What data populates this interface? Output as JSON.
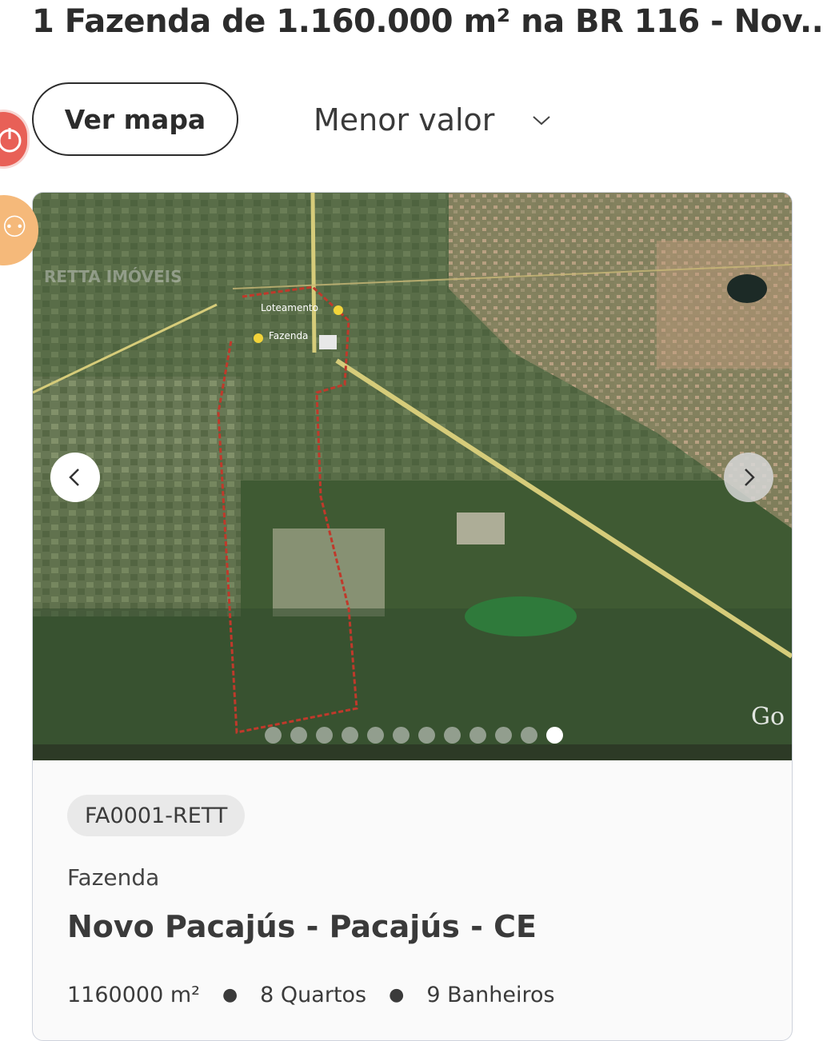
{
  "header": {
    "title": "1 Fazenda de 1.160.000 m² na BR 116 - Nov..."
  },
  "toolbar": {
    "map_button": "Ver mapa",
    "sort_selected": "Menor valor"
  },
  "listing": {
    "photo_overlay": {
      "watermark": "RETTA IMÓVEIS",
      "label_1": "Loteamento",
      "label_2": "Fazenda",
      "corner_text": "Go"
    },
    "carousel": {
      "total": 12,
      "active": 12
    },
    "code": "FA0001-RETT",
    "property_type": "Fazenda",
    "location": "Novo Pacajús - Pacajús - CE",
    "features": {
      "area": "1160000 m²",
      "rooms": "8 Quartos",
      "baths": "9 Banheiros"
    }
  },
  "icons": {
    "prev": "chevron-left-icon",
    "next": "chevron-right-icon",
    "sort": "chevron-down-icon",
    "float_1": "power-icon",
    "float_2": "accessibility-icon"
  },
  "colors": {
    "polygon": "#c0392b",
    "highway": "#d6cc7a",
    "fab_red": "#e86057",
    "fab_orange": "#f5b97a"
  }
}
